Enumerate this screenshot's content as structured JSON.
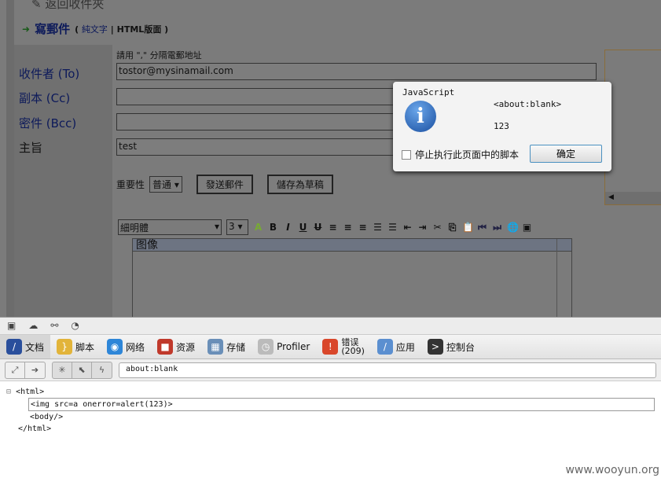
{
  "page": {
    "back_link": "返回收件夾",
    "title": "寫郵件",
    "mode_plain": "純文字",
    "mode_sep": "|",
    "mode_html": "HTML版面",
    "hint": "請用 \",\" 分隔電郵地址",
    "fields": [
      {
        "label": "收件者 (To)",
        "value": "tostor@mysinamail.com"
      },
      {
        "label": "副本 (Cc)",
        "value": ""
      },
      {
        "label": "密件 (Bcc)",
        "value": ""
      },
      {
        "label": "主旨",
        "value": "test"
      }
    ],
    "importance_label": "重要性",
    "importance_value": "普通",
    "send_button": "發送郵件",
    "draft_button": "儲存為草稿",
    "editor": {
      "font": "細明體",
      "size": "3",
      "image_label": "图像"
    }
  },
  "dialog": {
    "title": "JavaScript",
    "source": "<about:blank>",
    "message": "123",
    "checkbox_label": "停止执行此页面中的脚本",
    "ok": "确定"
  },
  "devtools": {
    "tabs": [
      {
        "label": "文档",
        "color": "#2a4f9c",
        "glyph": "/"
      },
      {
        "label": "脚本",
        "color": "#e2b43a",
        "glyph": "}"
      },
      {
        "label": "网络",
        "color": "#2e86d8",
        "glyph": "◉"
      },
      {
        "label": "资源",
        "color": "#c0392b",
        "glyph": "■"
      },
      {
        "label": "存储",
        "color": "#6a8fb8",
        "glyph": "▦"
      },
      {
        "label": "Profiler",
        "color": "#bbbbbb",
        "glyph": "◷"
      },
      {
        "label": "错误",
        "sub": "(209)",
        "color": "#d9472b",
        "glyph": "!"
      },
      {
        "label": "应用",
        "color": "#5b8fd0",
        "glyph": "/"
      },
      {
        "label": "控制台",
        "color": "#333333",
        "glyph": ">"
      }
    ],
    "url": "about:blank",
    "tree": [
      "<html>",
      "<img src=a onerror=alert(123)>",
      "<body/>",
      "</html>"
    ]
  },
  "watermark": "www.wooyun.org"
}
